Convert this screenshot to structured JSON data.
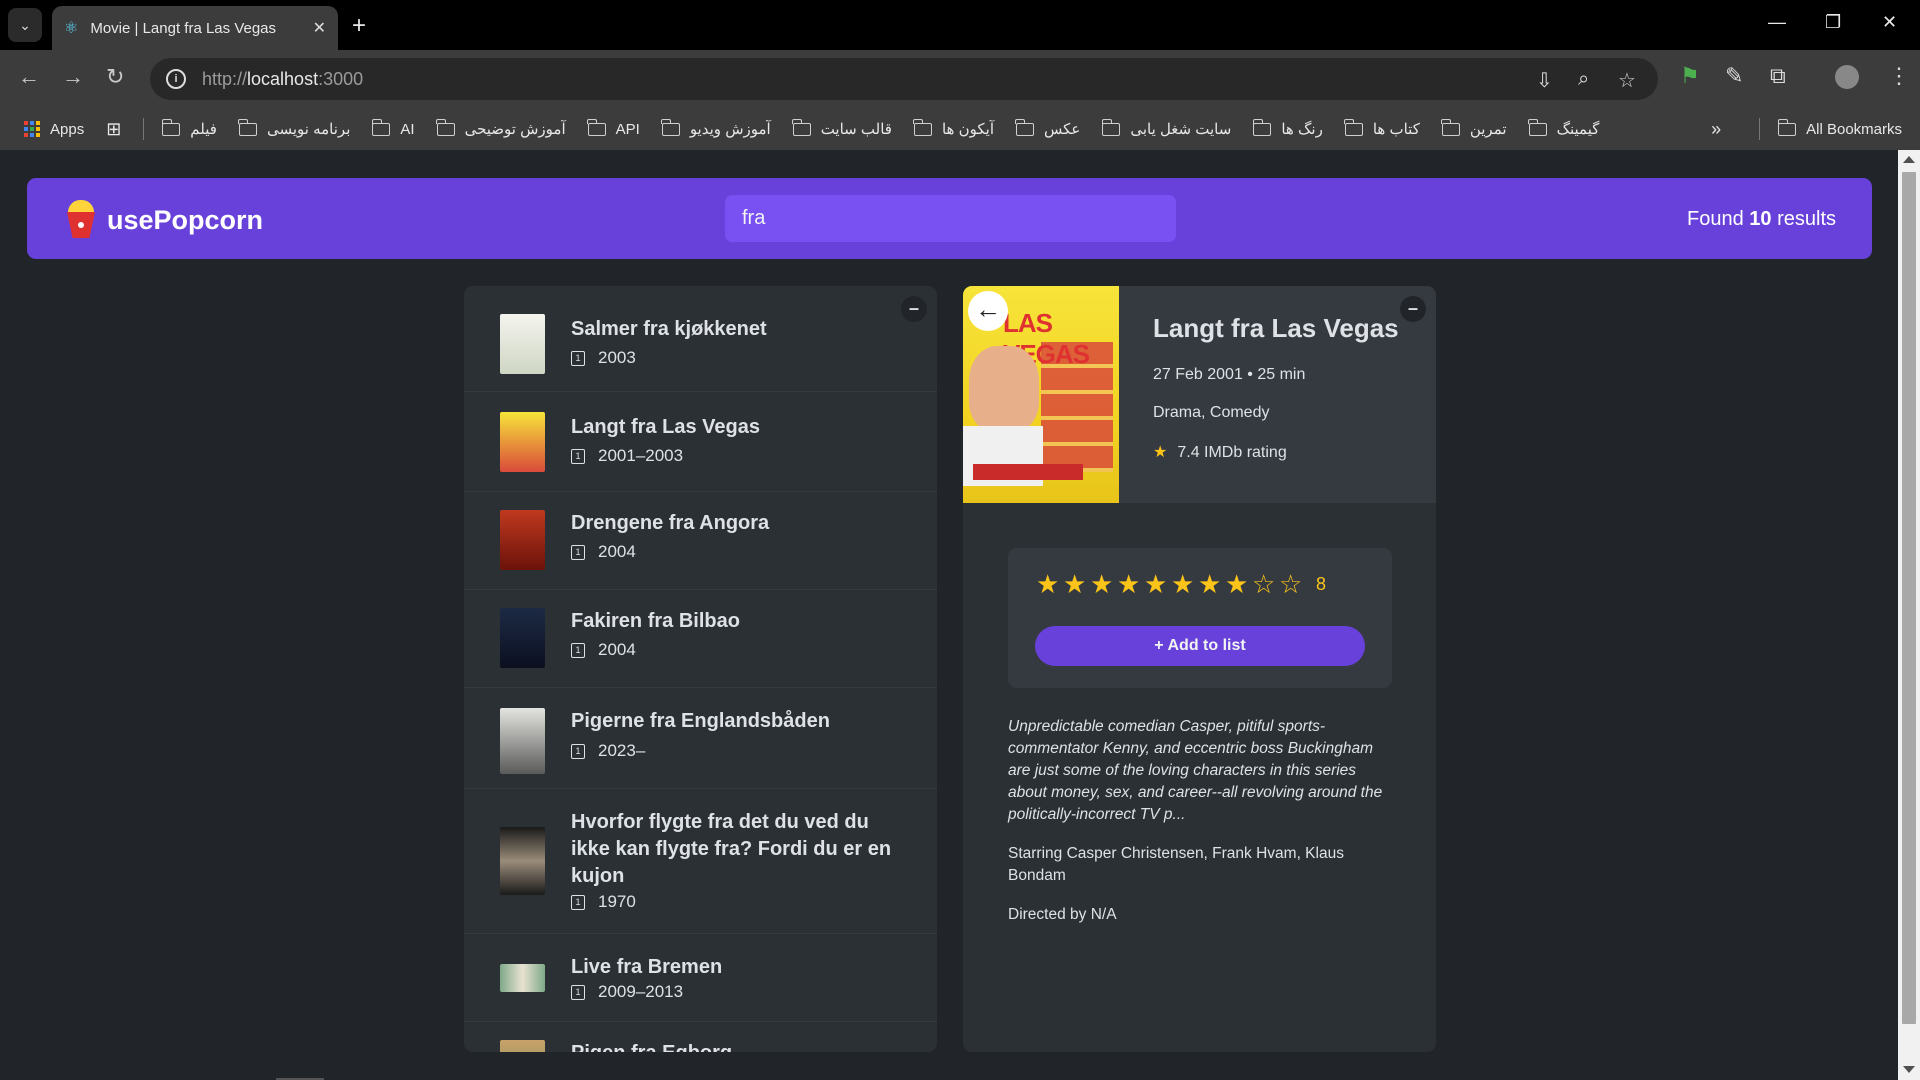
{
  "browser": {
    "tab_title": "Movie | Langt fra Las Vegas",
    "url_scheme": "http://",
    "url_host": "localhost",
    "url_port": ":3000",
    "bookmarks": [
      "فیلم",
      "برنامه نویسی",
      "AI",
      "آموزش توضیحی",
      "API",
      "آموزش ویدیو",
      "قالب سایت",
      "آیکون ها",
      "عکس",
      "سایت شغل یابی",
      "رنگ ها",
      "کتاب ها",
      "تمرین",
      "گیمینگ"
    ],
    "apps_label": "Apps",
    "all_bookmarks": "All Bookmarks"
  },
  "navbar": {
    "app_name": "usePopcorn",
    "search_value": "fra",
    "found_prefix": "Found",
    "found_count": "10",
    "found_suffix": "results"
  },
  "movies": [
    {
      "title": "Salmer fra kjøkkenet",
      "year": "2003"
    },
    {
      "title": "Langt fra Las Vegas",
      "year": "2001–2003"
    },
    {
      "title": "Drengene fra Angora",
      "year": "2004"
    },
    {
      "title": "Fakiren fra Bilbao",
      "year": "2004"
    },
    {
      "title": "Pigerne fra Englandsbåden",
      "year": "2023–"
    },
    {
      "title": "Hvorfor flygte fra det du ved du ikke kan flygte fra? Fordi du er en kujon",
      "year": "1970"
    },
    {
      "title": "Live fra Bremen",
      "year": "2009–2013"
    },
    {
      "title": "Pigen fra Egborg",
      "year": ""
    }
  ],
  "detail": {
    "title": "Langt fra Las Vegas",
    "released_runtime": "27 Feb 2001 • 25 min",
    "genre": "Drama, Comedy",
    "imdb": "7.4 IMDb rating",
    "user_rating": "8",
    "rating_max": 10,
    "rating_value": 8,
    "add_button": "+ Add to list",
    "plot": "Unpredictable comedian Casper, pitiful sports-commentator Kenny, and eccentric boss Buckingham are just some of the loving characters in this series about money, sex, and career--all revolving around the politically-incorrect TV p...",
    "starring": "Starring Casper Christensen, Frank Hvam, Klaus Bondam",
    "directed": "Directed by N/A",
    "poster_text": "LAS VEGAS"
  },
  "colors": {
    "primary": "#6741d9",
    "primary_light": "#7950f2",
    "background": "#212529",
    "box": "#2b3035",
    "star": "#fcc419"
  }
}
